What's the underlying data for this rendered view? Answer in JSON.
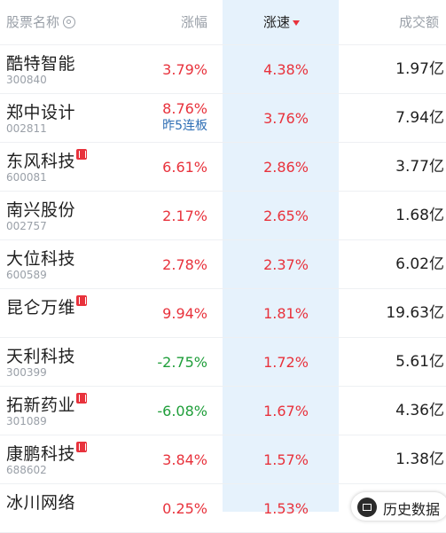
{
  "header": {
    "name": "股票名称",
    "change": "涨幅",
    "speed": "涨速",
    "turnover": "成交额"
  },
  "colors": {
    "up": "#e8323c",
    "down": "#1f9e3a",
    "highlight": "#e6f2fc"
  },
  "rows": [
    {
      "name": "酷特智能",
      "code": "300840",
      "change": "3.79%",
      "speed": "4.38%",
      "turnover": "1.97亿"
    },
    {
      "name": "郑中设计",
      "code": "002811",
      "change": "8.76%",
      "streak": "昨5连板",
      "speed": "3.76%",
      "turnover": "7.94亿"
    },
    {
      "name": "东风科技",
      "code": "600081",
      "change": "6.61%",
      "speed": "2.86%",
      "turnover": "3.77亿",
      "rong": true
    },
    {
      "name": "南兴股份",
      "code": "002757",
      "change": "2.17%",
      "speed": "2.65%",
      "turnover": "1.68亿"
    },
    {
      "name": "大位科技",
      "code": "600589",
      "change": "2.78%",
      "speed": "2.37%",
      "turnover": "6.02亿"
    },
    {
      "name": "昆仑万维",
      "code": "",
      "change": "9.94%",
      "speed": "1.81%",
      "turnover": "19.63亿",
      "rong": true
    },
    {
      "name": "天利科技",
      "code": "300399",
      "change": "-2.75%",
      "speed": "1.72%",
      "turnover": "5.61亿"
    },
    {
      "name": "拓新药业",
      "code": "301089",
      "change": "-6.08%",
      "speed": "1.67%",
      "turnover": "4.36亿",
      "rong": true
    },
    {
      "name": "康鹏科技",
      "code": "688602",
      "change": "3.84%",
      "speed": "1.57%",
      "turnover": "1.38亿",
      "rong": true
    },
    {
      "name": "冰川网络",
      "code": "",
      "change": "0.25%",
      "speed": "1.53%",
      "turnover": ""
    }
  ],
  "history_button": {
    "label": "历史数据",
    "icon": "calendar-icon"
  }
}
